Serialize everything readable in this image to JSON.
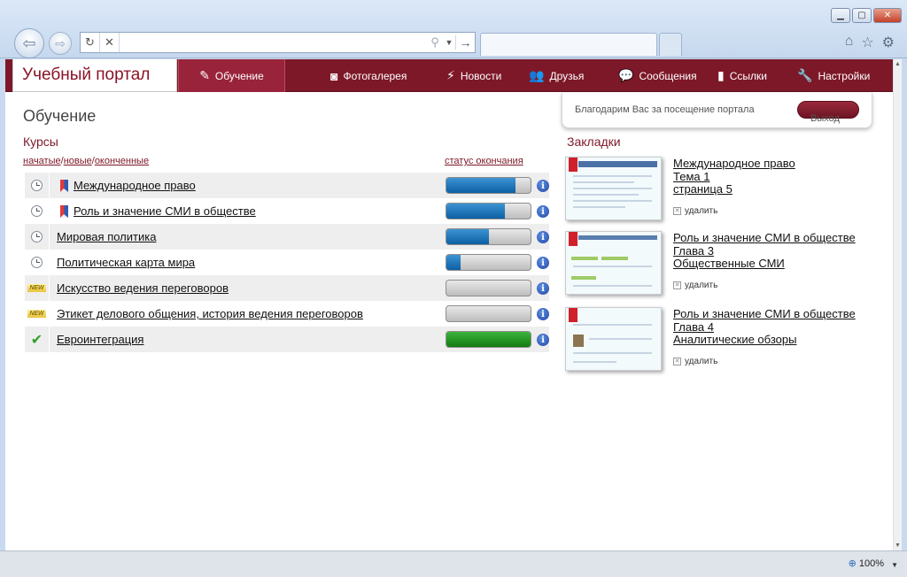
{
  "browser": {
    "address_value": "",
    "tab_title": "",
    "zoom": "100%"
  },
  "header": {
    "logo": "Учебный портал",
    "nav": [
      {
        "label": "Обучение",
        "icon": "pencil-icon",
        "active": true
      },
      {
        "label": "Фотогалерея",
        "icon": "camera-icon"
      },
      {
        "label": "Новости",
        "icon": "lightning-icon"
      },
      {
        "label": "Друзья",
        "icon": "users-icon"
      },
      {
        "label": "Сообщения",
        "icon": "speech-bubble-icon"
      },
      {
        "label": "Ссылки",
        "icon": "bookmark-icon"
      },
      {
        "label": "Настройки",
        "icon": "wrench-icon"
      }
    ]
  },
  "welcome": {
    "text": "Благодарим Вас за посещение портала",
    "logout": "Выход"
  },
  "page_title": "Обучение",
  "courses": {
    "title": "Курсы",
    "filters": [
      "начатые",
      "новые",
      "оконченные"
    ],
    "status_header": "статус окончания",
    "rows": [
      {
        "name": "Международное право",
        "status": "in-progress",
        "bookmarked": true,
        "progress": 0.82
      },
      {
        "name": "Роль и значение СМИ в обществе",
        "status": "in-progress",
        "bookmarked": true,
        "progress": 0.69
      },
      {
        "name": "Мировая политика",
        "status": "in-progress",
        "bookmarked": false,
        "progress": 0.51
      },
      {
        "name": "Политическая карта мира",
        "status": "in-progress",
        "bookmarked": false,
        "progress": 0.17
      },
      {
        "name": "Искусство ведения переговоров",
        "status": "new",
        "bookmarked": false,
        "progress": 0
      },
      {
        "name": "Этикет делового общения, история ведения переговоров",
        "status": "new",
        "bookmarked": false,
        "progress": 0
      },
      {
        "name": "Евроинтеграция",
        "status": "completed",
        "bookmarked": false,
        "progress": 1.0
      }
    ]
  },
  "bookmarks": {
    "title": "Закладки",
    "delete_label": "удалить",
    "items": [
      {
        "line1": "Международное право",
        "line2": "Тема 1",
        "line3": "страница 5"
      },
      {
        "line1": "Роль и значение СМИ в обществе",
        "line2": "Глава 3",
        "line3": "Общественные СМИ"
      },
      {
        "line1": "Роль и значение СМИ в обществе",
        "line2": "Глава 4",
        "line3": "Аналитические обзоры"
      }
    ]
  },
  "colors": {
    "brand": "#7d1828",
    "progress_blue": "#1a6fb3",
    "progress_green": "#1f8f1f"
  }
}
